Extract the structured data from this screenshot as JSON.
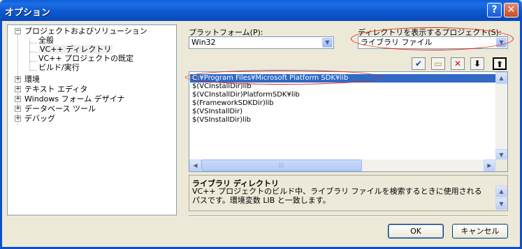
{
  "window": {
    "title": "オプション",
    "help_glyph": "?",
    "close_glyph": "✕"
  },
  "tree": {
    "root": {
      "label": "プロジェクトおよびソリューション",
      "expander": "−",
      "children": [
        "全般",
        "VC++ ディレクトリ",
        "VC++ プロジェクトの既定",
        "ビルド/実行"
      ]
    },
    "collapsed": [
      "環境",
      "テキスト エディタ",
      "Windows フォーム デザイナ",
      "データベース ツール",
      "デバッグ"
    ],
    "collapsed_expander": "+"
  },
  "platform": {
    "label": "プラットフォーム(P):",
    "value": "Win32"
  },
  "directory_for": {
    "label": "ディレクトリを表示するプロジェクト(S):",
    "value": "ライブラリ ファイル"
  },
  "toolbar": {
    "check_glyph": "✔",
    "folder_glyph": "▭",
    "delete_glyph": "✕",
    "down_glyph": "⬇",
    "up_glyph": "⬆"
  },
  "directories": [
    "C:¥Program Files¥Microsoft Platform SDK¥lib",
    "$(VCInstallDir)lib",
    "$(VCInstallDir)PlatformSDK¥lib",
    "$(FrameworkSDKDir)lib",
    "$(VSInstallDir)",
    "$(VSInstallDir)lib"
  ],
  "scrollbar_glyphs": {
    "up": "▲",
    "down": "▼",
    "left": "◀",
    "right": "▶",
    "grip": "|||"
  },
  "description": {
    "title": "ライブラリ ディレクトリ",
    "text": "VC++ プロジェクトのビルド中、ライブラリ ファイルを検索するときに使用されるパスです。環境変数 LIB と一致します。"
  },
  "buttons": {
    "ok": "OK",
    "cancel": "キャンセル"
  },
  "colors": {
    "selection": "#316ac5",
    "annotation": "#e02020",
    "titlebar": "#0a5fd7"
  }
}
